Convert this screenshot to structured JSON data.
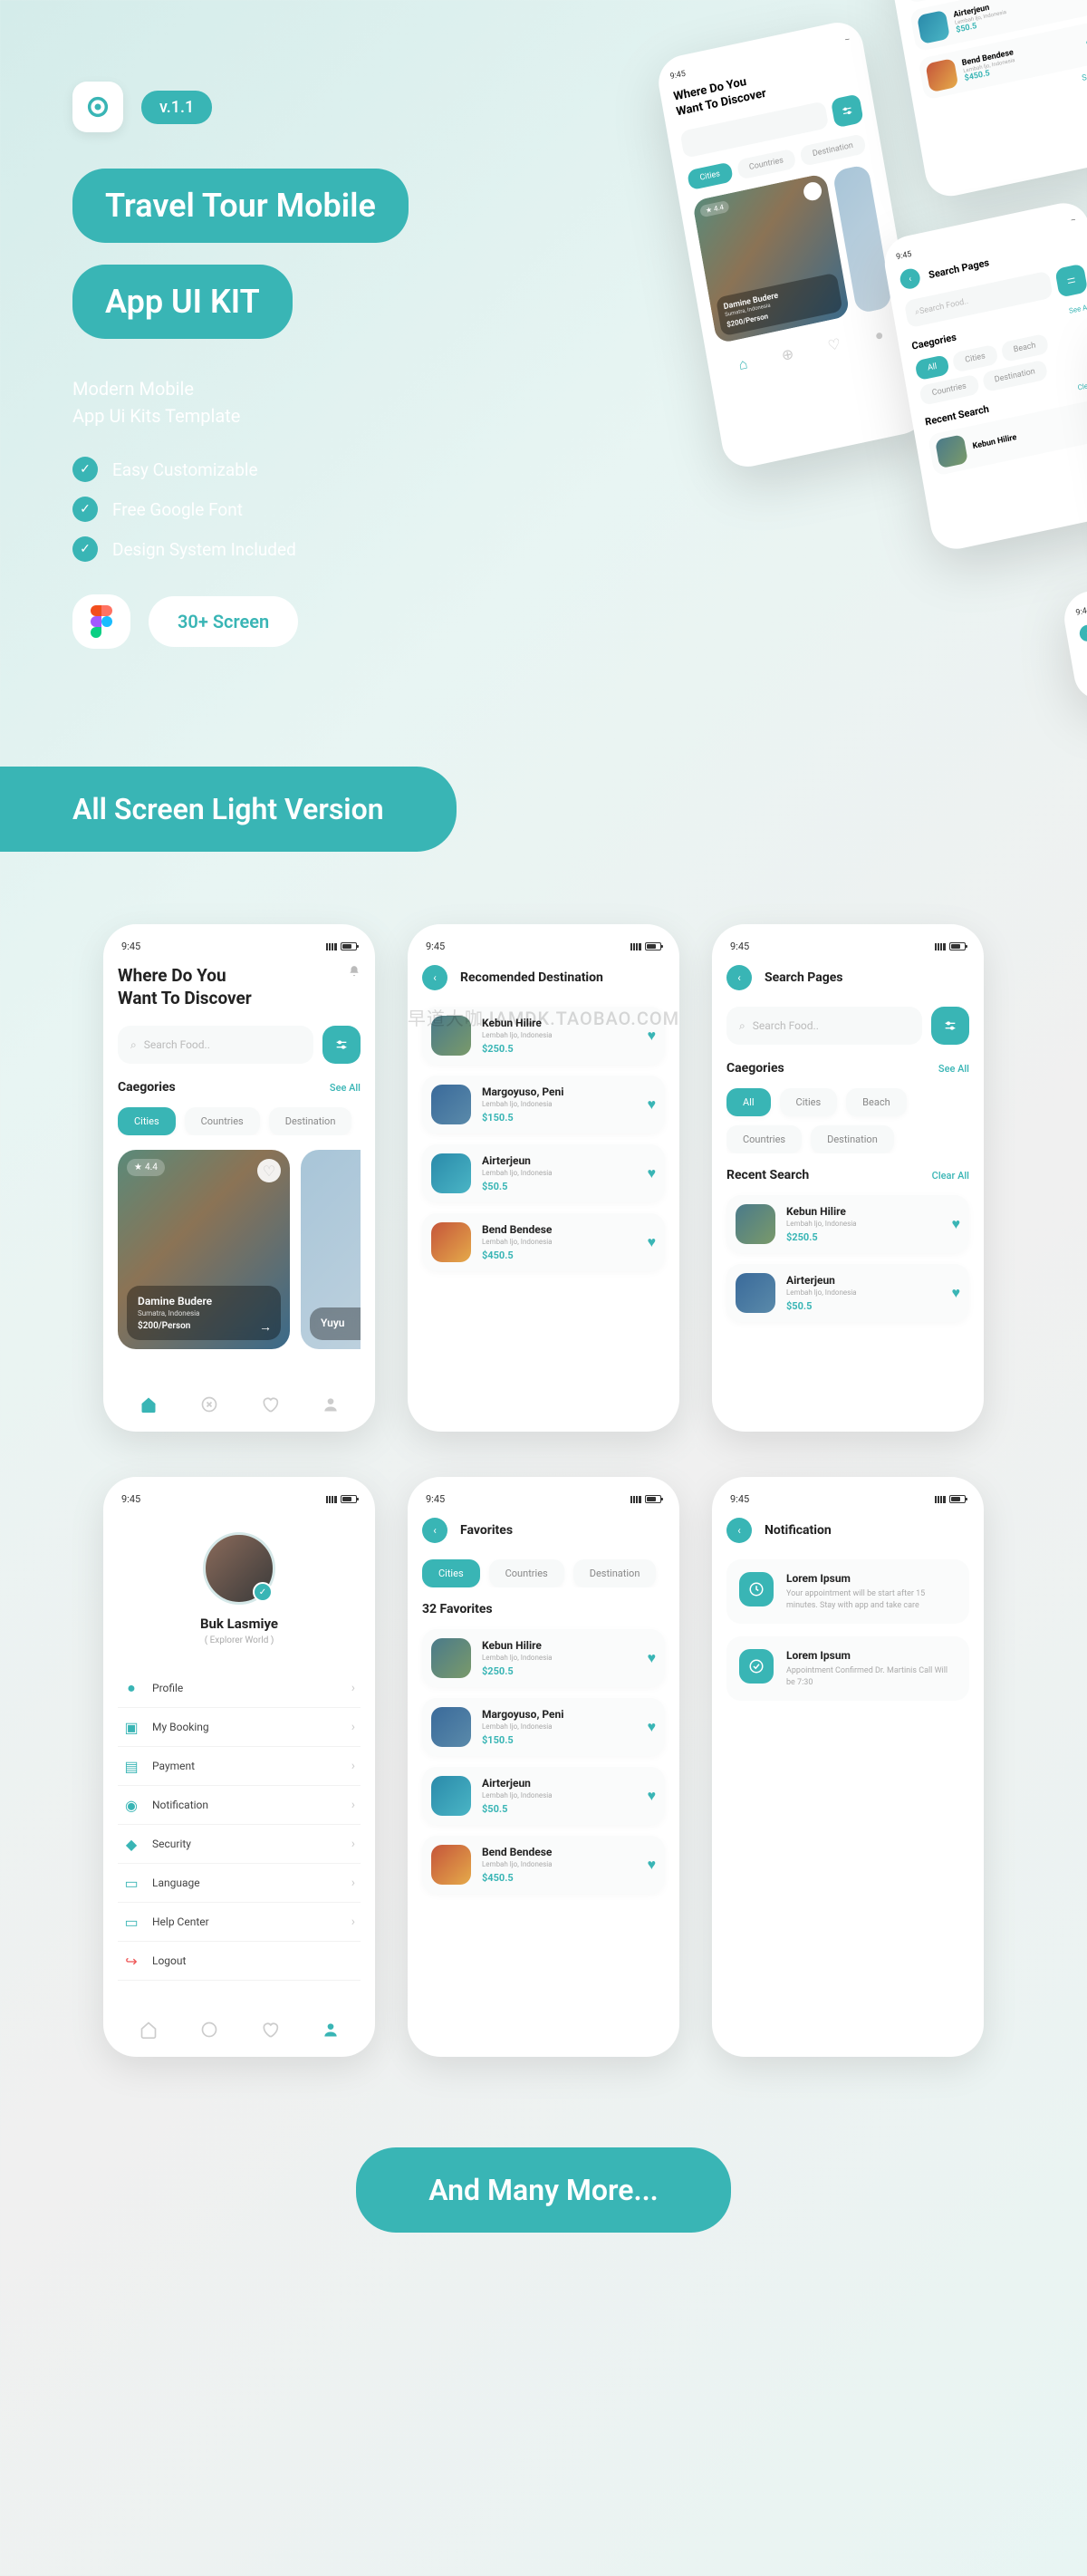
{
  "version": "v.1.1",
  "title1": "Travel Tour  Mobile",
  "title2": "App UI KIT",
  "subtitle": "Modern   Mobile\nApp Ui Kits Template",
  "features": [
    "Easy Customizable",
    "Free Google Font",
    "Design System Included"
  ],
  "screen_count": "30+ Screen",
  "section_header": "All Screen Light Version",
  "footer": "And Many More...",
  "watermark": "早道大咖  IAMDK.TAOBAO.COM",
  "time": "9:45",
  "home": {
    "heading": "Where Do You\nWant To Discover",
    "search_placeholder": "Search Food..",
    "categories_label": "Caegories",
    "see_all": "See All",
    "chips": [
      "Cities",
      "Countries",
      "Destination"
    ],
    "card": {
      "name": "Damine Budere",
      "location": "Sumatra, Indonesia",
      "price": "$200/Person",
      "rating": "4.4"
    },
    "card2": {
      "name": "Yuyu"
    }
  },
  "recommended": {
    "title": "Recomended Destination",
    "items": [
      {
        "name": "Kebun Hilire",
        "loc": "Lembah ljo, Indonesia",
        "price": "$250.5"
      },
      {
        "name": "Margoyuso, Peni",
        "loc": "Lembah ljo, Indonesia",
        "price": "$150.5"
      },
      {
        "name": "Airterjeun",
        "loc": "Lembah ljo, Indonesia",
        "price": "$50.5"
      },
      {
        "name": "Bend Bendese",
        "loc": "Lembah ljo, Indonesia",
        "price": "$450.5"
      }
    ]
  },
  "search": {
    "title": "Search Pages",
    "placeholder": "Search Food..",
    "categories_label": "Caegories",
    "see_all": "See All",
    "chips": [
      "All",
      "Cities",
      "Beach",
      "Countries",
      "Destination"
    ],
    "recent_label": "Recent Search",
    "clear_all": "Clear All",
    "recent": [
      {
        "name": "Kebun Hilire",
        "loc": "Lembah ljo, Indonesia",
        "price": "$250.5"
      },
      {
        "name": "Airterjeun",
        "loc": "Lembah ljo, Indonesia",
        "price": "$50.5"
      }
    ]
  },
  "profile": {
    "name": "Buk Lasmiye",
    "sub": "( Explorer World )",
    "menu": [
      "Profile",
      "My Booking",
      "Payment",
      "Notification",
      "Security",
      "Language",
      "Help Center",
      "Logout"
    ]
  },
  "favorites": {
    "title": "Favorites",
    "chips": [
      "Cities",
      "Countries",
      "Destination"
    ],
    "count": "32 Favorites",
    "items": [
      {
        "name": "Kebun Hilire",
        "loc": "Lembah ljo, Indonesia",
        "price": "$250.5"
      },
      {
        "name": "Margoyuso, Peni",
        "loc": "Lembah ljo, Indonesia",
        "price": "$150.5"
      },
      {
        "name": "Airterjeun",
        "loc": "Lembah ljo, Indonesia",
        "price": "$50.5"
      },
      {
        "name": "Bend Bendese",
        "loc": "Lembah ljo, Indonesia",
        "price": "$450.5"
      }
    ]
  },
  "notification": {
    "title": "Notification",
    "items": [
      {
        "title": "Lorem Ipsum",
        "body": "Your appointment will be start after 15 minutes. Stay with app and take care"
      },
      {
        "title": "Lorem Ipsum",
        "body": "Appointment Confirmed Dr. Martinis Call Will be 7:30"
      }
    ]
  },
  "hero_list": {
    "items": [
      {
        "name": "Margoyuso, Peni",
        "loc": "Lembah ljo, Indonesia",
        "price": "$150.5"
      },
      {
        "name": "Airterjeun",
        "loc": "Lembah ljo, Indonesia",
        "price": "$50.5"
      },
      {
        "name": "Bend Bendese",
        "loc": "Lembah ljo, Indonesia",
        "price": "$450.5"
      }
    ],
    "see_all": "See All"
  }
}
